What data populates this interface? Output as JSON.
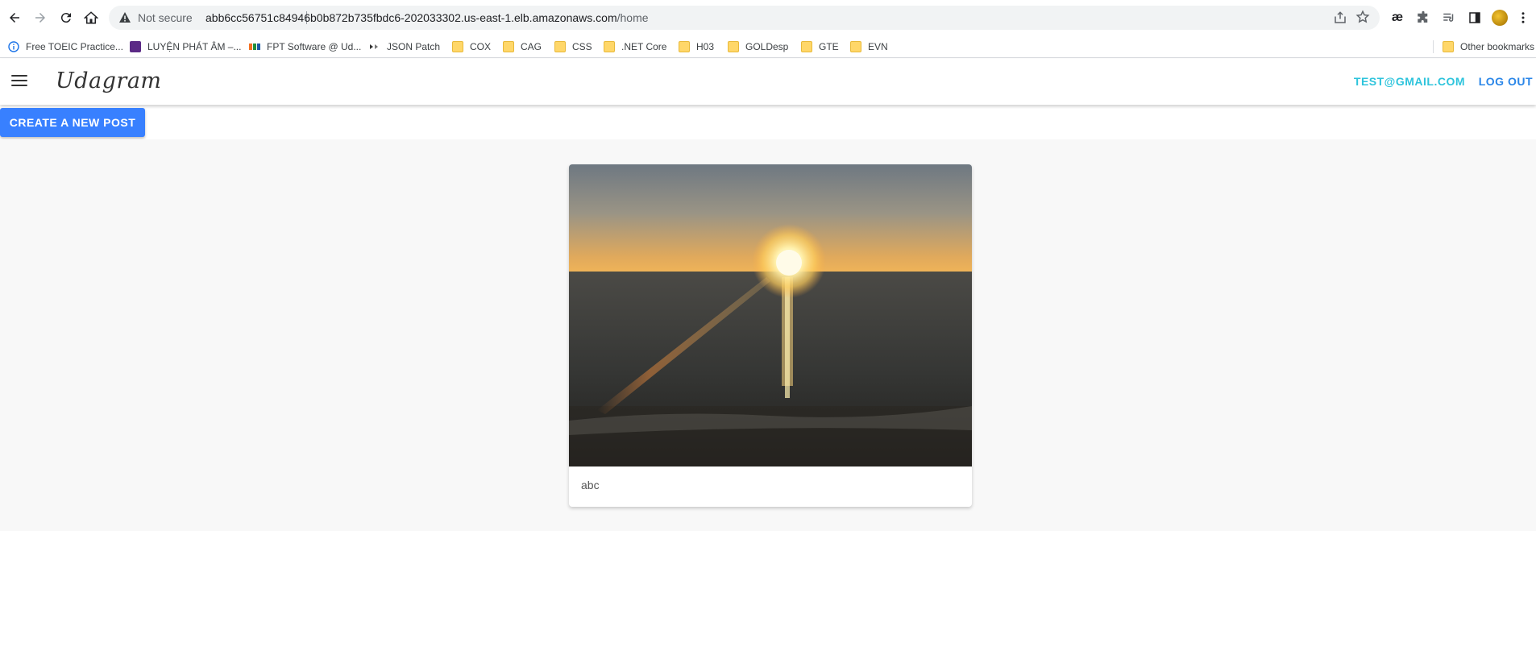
{
  "browser": {
    "security_label": "Not secure",
    "url_host": "abb6cc56751c84946b0b872b735fbdc6-202033302.us-east-1.elb.amazonaws.com",
    "url_path": "/home"
  },
  "bookmarks": [
    {
      "label": "Free TOEIC Practice...",
      "icon": "info-icon"
    },
    {
      "label": "LUYỆN PHÁT ÂM –...",
      "icon": "site-favicon"
    },
    {
      "label": "FPT Software @ Ud...",
      "icon": "fpt-favicon"
    },
    {
      "label": "JSON Patch",
      "icon": "jsonpatch-favicon"
    },
    {
      "label": "COX",
      "icon": "folder-icon"
    },
    {
      "label": "CAG",
      "icon": "folder-icon"
    },
    {
      "label": "CSS",
      "icon": "folder-icon"
    },
    {
      "label": ".NET Core",
      "icon": "folder-icon"
    },
    {
      "label": "H03",
      "icon": "folder-icon"
    },
    {
      "label": "GOLDesp",
      "icon": "folder-icon"
    },
    {
      "label": "GTE",
      "icon": "folder-icon"
    },
    {
      "label": "EVN",
      "icon": "folder-icon"
    }
  ],
  "other_bookmarks": "Other bookmarks",
  "extensions": {
    "ae_label": "æ"
  },
  "app": {
    "logo": "Udagram",
    "user_email": "TEST@GMAIL.COM",
    "logout": "LOG OUT",
    "create_post": "CREATE A NEW POST"
  },
  "feed": {
    "posts": [
      {
        "caption": "abc",
        "image": "sunset over ocean photo"
      }
    ]
  },
  "colors": {
    "create_button": "#3880ff",
    "email_link": "#2ec4dc",
    "logout_link": "#2a86e8",
    "feed_background": "#f8f8f8"
  }
}
